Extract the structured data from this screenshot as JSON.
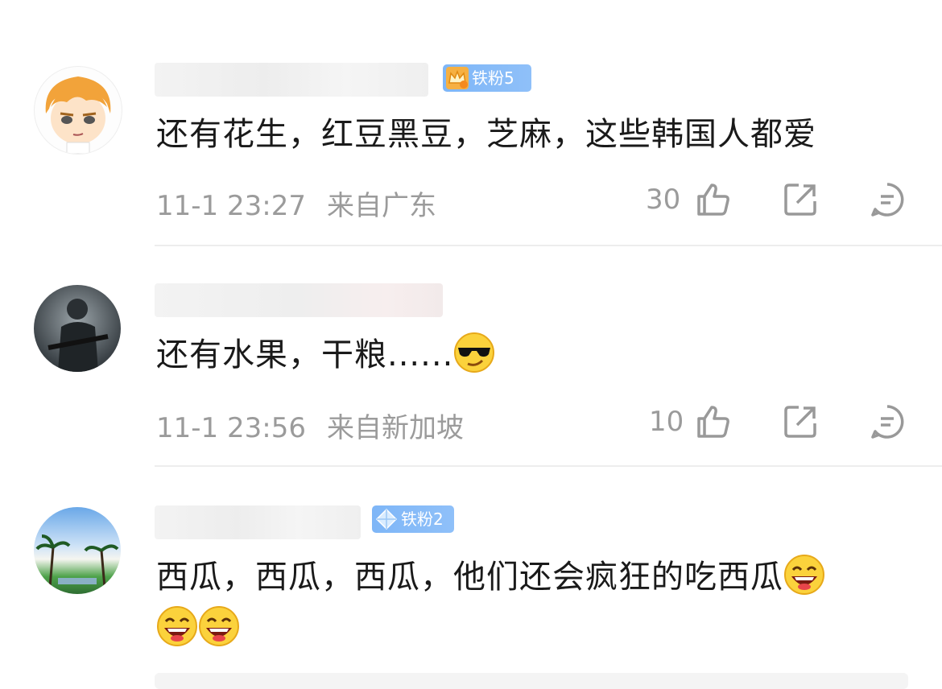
{
  "comments": [
    {
      "badge": "铁粉5",
      "text": "还有花生，红豆黑豆，芝麻，这些韩国人都爱",
      "time": "11-1 23:27",
      "location": "来自广东",
      "likes": "30"
    },
    {
      "badge": "",
      "text": "还有水果，干粮......",
      "time": "11-1 23:56",
      "location": "来自新加坡",
      "likes": "10"
    },
    {
      "badge": "铁粉2",
      "text_line1": "西瓜，西瓜，西瓜，他们还会疯狂的吃西瓜",
      "text_line2": ""
    }
  ],
  "icons": [
    "like-icon",
    "share-icon",
    "comment-icon",
    "crown-icon",
    "diamond-icon",
    "cool-emoji-icon",
    "laugh-emoji-icon"
  ],
  "colors": {
    "badge": "#7eb6f7",
    "meta": "#9b9b9b",
    "text": "#1a1a1a",
    "divider": "#ededed"
  }
}
